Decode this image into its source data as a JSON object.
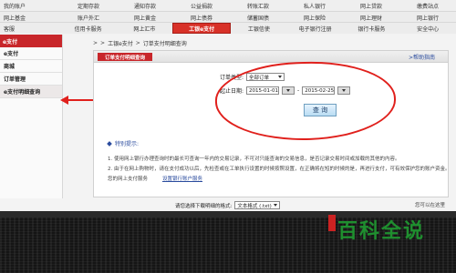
{
  "top_menu": {
    "row1": [
      "我的账户",
      "定期存款",
      "通知存款",
      "公益捐款",
      "转账汇款",
      "私人银行",
      "网上贷款",
      "缴费站点"
    ],
    "row2": [
      "网上基金",
      "账户外汇",
      "网上黄金",
      "网上债券",
      "储蓄国债",
      "网上保险",
      "网上理财",
      "网上银行"
    ],
    "row3": [
      "客服",
      "信用卡服务",
      "网上汇市",
      "工银e支付",
      "工银信使",
      "电子银行注册",
      "银行卡服务",
      "安全中心"
    ],
    "highlight_index": 3
  },
  "sidebar": {
    "header": "e支付",
    "items": [
      "e支付",
      "商城",
      "订单管理",
      "e支付明细查询"
    ],
    "active_index": 3
  },
  "breadcrumb": {
    "separator": ">",
    "items": [
      "工银e支付",
      "订单支付明细查询"
    ]
  },
  "panel": {
    "title": "订单支付明细查询",
    "help_link": "帮助指南"
  },
  "form": {
    "order_type_label": "订单类型:",
    "order_type_value": "全部订单",
    "date_label": "起止日期:",
    "start_date": "2015-01-01",
    "date_sep": "-",
    "end_date": "2015-02-25",
    "query_button": "查 询"
  },
  "tips": {
    "title": "特别提示:",
    "lines": [
      "1. 使用网上银行办理查询时的最长可查询一年内的交易记录，不可对只能查询的交易信息，是否记录交易时间或加载的其他的内容。",
      "2. 由于在网上购物时，请在支付成功以后，先检查或在工单执行设置的时候按照设置，在正确将在短的时候的是，再进行支付，可有效保护您的账户资金。",
      "您的网上支付服务",
      "设置银行账户服务"
    ]
  },
  "download": {
    "label": "请您选择下载明细的格式:",
    "format_value": "文本格式 (.txt)",
    "right_note": "您可以在这里"
  },
  "watermark": {
    "text": "百科全说"
  }
}
